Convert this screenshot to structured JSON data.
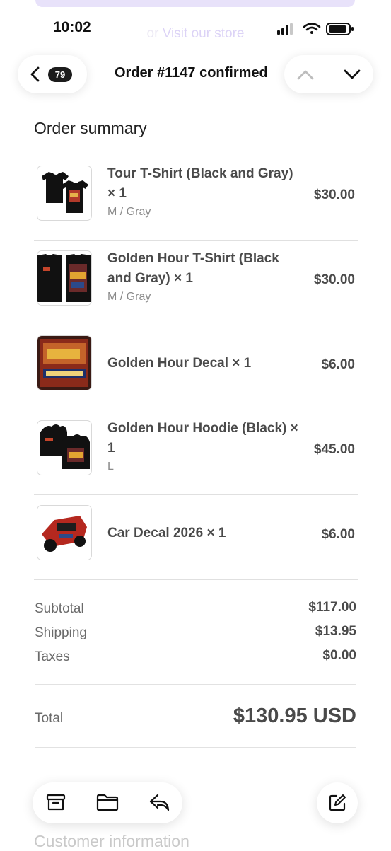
{
  "status_bar": {
    "time": "10:02"
  },
  "behind_content": {
    "or_text": "or",
    "link_text": "Visit our store"
  },
  "nav": {
    "unread_count": "79",
    "title": "Order #1147 confirmed"
  },
  "order_summary": {
    "heading": "Order summary",
    "items": [
      {
        "name": "Tour T-Shirt (Black and Gray) × 1",
        "variant": "M / Gray",
        "price": "$30.00"
      },
      {
        "name": "Golden Hour T-Shirt (Black and Gray) × 1",
        "variant": "M / Gray",
        "price": "$30.00"
      },
      {
        "name": "Golden Hour Decal × 1",
        "variant": "",
        "price": "$6.00"
      },
      {
        "name": "Golden Hour Hoodie (Black) × 1",
        "variant": "L",
        "price": "$45.00"
      },
      {
        "name": "Car Decal 2026 × 1",
        "variant": "",
        "price": "$6.00"
      }
    ]
  },
  "totals": {
    "subtotal_label": "Subtotal",
    "subtotal": "$117.00",
    "shipping_label": "Shipping",
    "shipping": "$13.95",
    "taxes_label": "Taxes",
    "taxes": "$0.00",
    "total_label": "Total",
    "total": "$130.95 USD"
  },
  "next_section": {
    "heading": "Customer information"
  },
  "colors": {
    "accent_banner": "#e8e2fa",
    "text_dark": "#111111",
    "text_muted": "#8a8a8a"
  }
}
